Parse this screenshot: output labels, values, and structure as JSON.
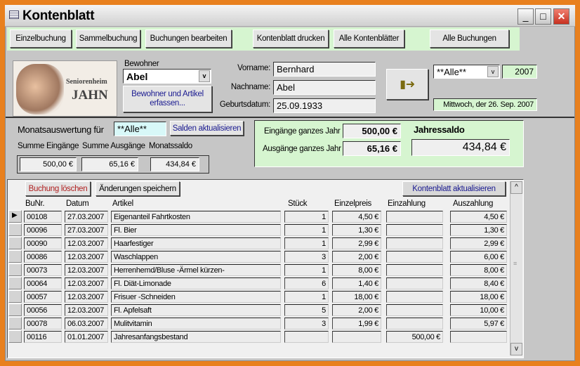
{
  "window": {
    "title": "Kontenblatt",
    "min": "_",
    "max": "□",
    "close": "✕"
  },
  "toolbar": [
    "Einzelbuchung",
    "Sammelbuchung",
    "Buchungen bearbeiten",
    "Kontenblatt drucken",
    "Alle Kontenblätter",
    "Alle Buchungen"
  ],
  "logo": {
    "line1": "Seniorenheim",
    "line2": "JAHN"
  },
  "bewohner": {
    "label": "Bewohner",
    "value": "Abel",
    "button": "Bewohner und Artikel erfassen..."
  },
  "person": {
    "vorname_label": "Vorname:",
    "vorname": "Bernhard",
    "nachname_label": "Nachname:",
    "nachname": "Abel",
    "geburt_label": "Geburtsdatum:",
    "geburt": "25.09.1933"
  },
  "filter": {
    "value": "**Alle**",
    "year": "2007",
    "date": "Mittwoch, der 26. Sep. 2007"
  },
  "monat": {
    "label": "Monatsauswertung für",
    "value": "**Alle**",
    "button": "Salden aktualisieren",
    "sum_in_label": "Summe Eingänge",
    "sum_out_label": "Summe Ausgänge",
    "saldo_label": "Monatssaldo",
    "sum_in": "500,00 €",
    "sum_out": "65,16 €",
    "saldo": "434,84 €"
  },
  "jahr": {
    "in_label": "Eingänge ganzes Jahr",
    "in": "500,00 €",
    "out_label": "Ausgänge ganzes Jahr",
    "out": "65,16 €",
    "saldo_label": "Jahressaldo",
    "saldo": "434,84 €"
  },
  "sub": {
    "delete": "Buchung löschen",
    "save": "Änderungen speichern",
    "refresh": "Kontenblatt aktualisieren"
  },
  "columns": [
    "BuNr.",
    "Datum",
    "Artikel",
    "Stück",
    "Einzelpreis",
    "Einzahlung",
    "Auszahlung"
  ],
  "rows": [
    [
      "00108",
      "27.03.2007",
      "Eigenanteil Fahrtkosten",
      "1",
      "4,50 €",
      "",
      "4,50 €"
    ],
    [
      "00096",
      "27.03.2007",
      "Fl. Bier",
      "1",
      "1,30 €",
      "",
      "1,30 €"
    ],
    [
      "00090",
      "12.03.2007",
      "Haarfestiger",
      "1",
      "2,99 €",
      "",
      "2,99 €"
    ],
    [
      "00086",
      "12.03.2007",
      "Waschlappen",
      "3",
      "2,00 €",
      "",
      "6,00 €"
    ],
    [
      "00073",
      "12.03.2007",
      "Herrenhemd/Bluse -Ärmel kürzen-",
      "1",
      "8,00 €",
      "",
      "8,00 €"
    ],
    [
      "00064",
      "12.03.2007",
      "Fl. Diät-Limonade",
      "6",
      "1,40 €",
      "",
      "8,40 €"
    ],
    [
      "00057",
      "12.03.2007",
      "Frisuer -Schneiden",
      "1",
      "18,00 €",
      "",
      "18,00 €"
    ],
    [
      "00056",
      "12.03.2007",
      "Fl. Apfelsaft",
      "5",
      "2,00 €",
      "",
      "10,00 €"
    ],
    [
      "00078",
      "06.03.2007",
      "Mulitvitamin",
      "3",
      "1,99 €",
      "",
      "5,97 €"
    ],
    [
      "00116",
      "01.01.2007",
      "Jahresanfangsbestand",
      "",
      "",
      "500,00 €",
      ""
    ]
  ]
}
